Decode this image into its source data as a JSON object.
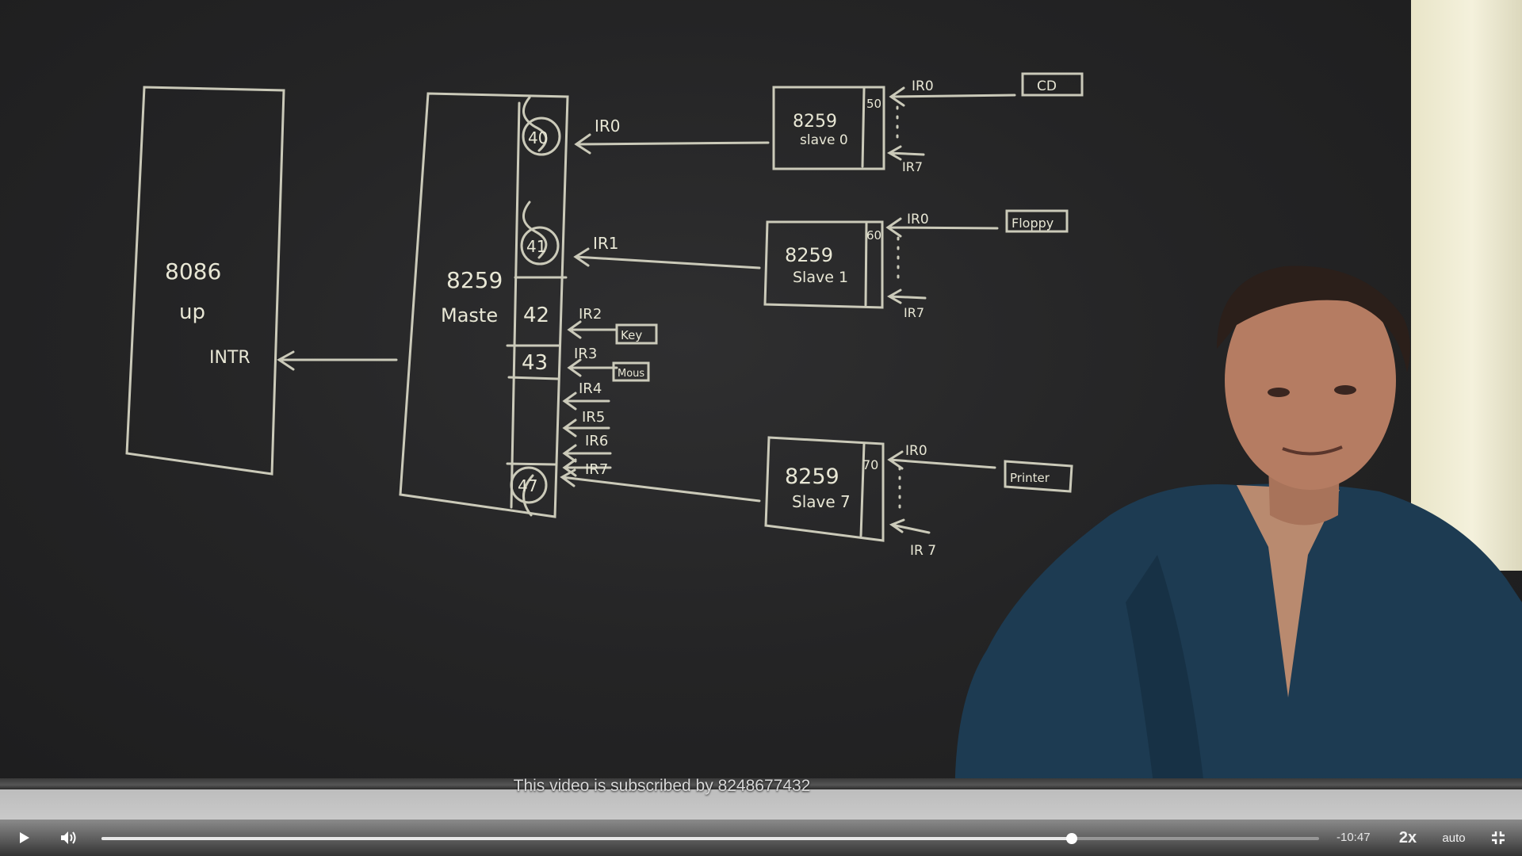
{
  "board": {
    "cpu": {
      "title": "8086",
      "subtitle": "up",
      "pin": "INTR"
    },
    "master": {
      "title": "8259",
      "subtitle": "Maste",
      "vectors": [
        "40",
        "41",
        "42",
        "43",
        "47"
      ]
    },
    "master_inputs": [
      "IR0",
      "IR1",
      "IR2",
      "IR3",
      "IR4",
      "IR5",
      "IR6",
      "IR7"
    ],
    "devices": [
      "Key",
      "Mous"
    ],
    "slaves": [
      {
        "title": "8259",
        "subtitle": "slave 0",
        "vector": "50",
        "first_input": "IR0",
        "last_input": "IR7",
        "device": "CD"
      },
      {
        "title": "8259",
        "subtitle": "Slave 1",
        "vector": "60",
        "first_input": "IR0",
        "last_input": "IR7",
        "device": "Floppy"
      },
      {
        "title": "8259",
        "subtitle": "Slave 7",
        "vector": "70",
        "first_input": "IR0",
        "last_input": "IR 7",
        "device": "Printer"
      }
    ]
  },
  "overlay": {
    "subscription_text": "This video is subscribed by 8248677432"
  },
  "controls": {
    "play_icon": "play-icon",
    "volume_icon": "volume-icon",
    "progress": 0.797,
    "time_remaining": "-10:47",
    "speed": "2x",
    "quality": "auto",
    "fullscreen_icon": "exit-fullscreen-icon"
  }
}
